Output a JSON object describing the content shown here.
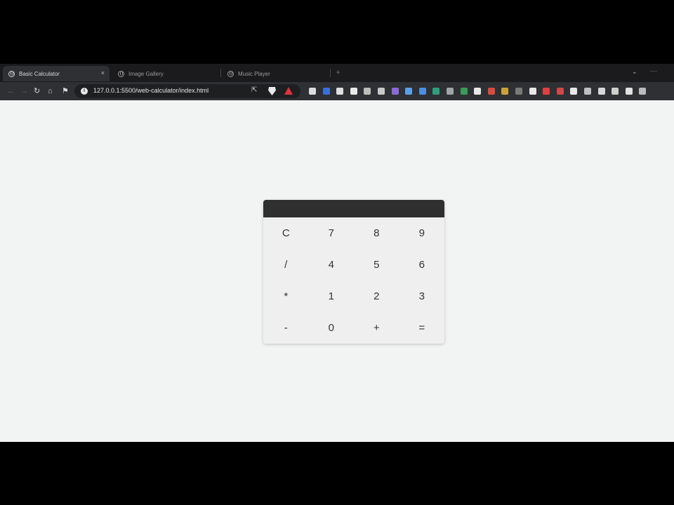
{
  "browser": {
    "tabs": [
      {
        "label": "Basic Calculator",
        "active": true
      },
      {
        "label": "Image Gallery",
        "active": false
      },
      {
        "label": "Music Player",
        "active": false
      }
    ],
    "new_tab_symbol": "+",
    "tab_menu_symbol": "⌄",
    "close_symbol": "×",
    "minimize_symbol": "—",
    "url": "127.0.0.1:5500/web-calculator/index.html",
    "info_symbol": "i",
    "nav": {
      "back": "←",
      "forward": "→",
      "reload": "↻",
      "home": "⌂",
      "bookmark": "⚑",
      "share": "⇱"
    },
    "extension_colors": [
      "#dcdcdc",
      "#3b6fd8",
      "#e0e0e0",
      "#e9e9e9",
      "#bdbdbd",
      "#c8c8c8",
      "#8c6ad8",
      "#5aa0e8",
      "#4a8fe0",
      "#2e9e7a",
      "#9ea4a8",
      "#3a9a5a",
      "#e8e8e8",
      "#d84b3f",
      "#c9a33a",
      "#7a7a7a",
      "#e8e8e8",
      "#e04040",
      "#d04848",
      "#e8e8e8",
      "#c0c0c0",
      "#d8d8d8",
      "#cfcfcf",
      "#e2e2e2",
      "#bbbbbb"
    ]
  },
  "calculator": {
    "display_value": "",
    "keys": [
      "C",
      "7",
      "8",
      "9",
      "/",
      "4",
      "5",
      "6",
      "*",
      "1",
      "2",
      "3",
      "-",
      "0",
      "+",
      "="
    ]
  }
}
